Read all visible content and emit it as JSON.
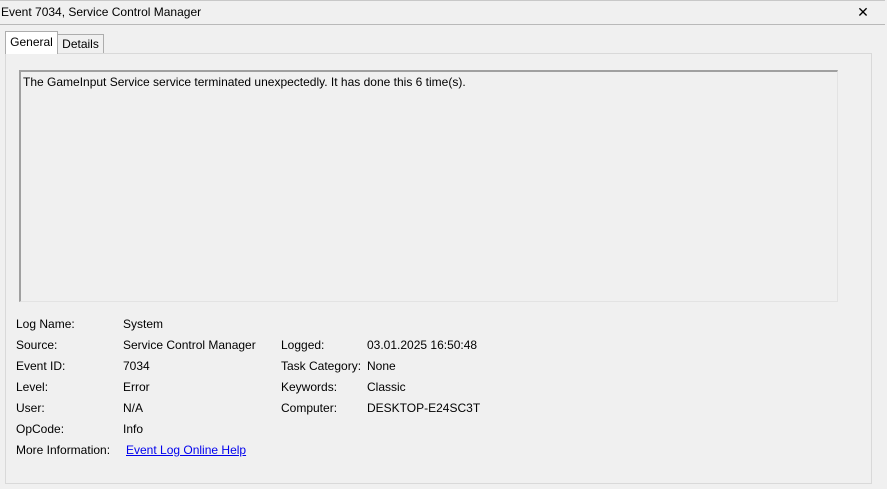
{
  "window": {
    "title": "Event 7034, Service Control Manager",
    "close_glyph": "✕"
  },
  "tabs": [
    {
      "label": "General",
      "active": true
    },
    {
      "label": "Details",
      "active": false
    }
  ],
  "general": {
    "description": "The GameInput Service service terminated unexpectedly.  It has done this 6 time(s).",
    "fields": {
      "log_name": {
        "label": "Log Name:",
        "value": "System"
      },
      "source": {
        "label": "Source:",
        "value": "Service Control Manager"
      },
      "event_id": {
        "label": "Event ID:",
        "value": "7034"
      },
      "level": {
        "label": "Level:",
        "value": "Error"
      },
      "user": {
        "label": "User:",
        "value": "N/A"
      },
      "opcode": {
        "label": "OpCode:",
        "value": "Info"
      },
      "more_info": {
        "label": "More Information:",
        "value": "Event Log Online Help"
      },
      "logged": {
        "label": "Logged:",
        "value": "03.01.2025 16:50:48"
      },
      "task_category": {
        "label": "Task Category:",
        "value": "None"
      },
      "keywords": {
        "label": "Keywords:",
        "value": "Classic"
      },
      "computer": {
        "label": "Computer:",
        "value": "DESKTOP-E24SC3T"
      }
    }
  }
}
